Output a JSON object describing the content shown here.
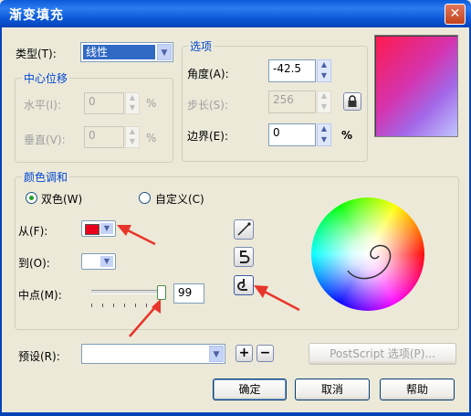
{
  "window": {
    "title": "渐变填充",
    "close_glyph": "✕"
  },
  "type": {
    "label": "类型(T):",
    "value": "线性"
  },
  "center": {
    "title": "中心位移",
    "horizontal": {
      "label": "水平(I):",
      "value": "0",
      "unit": "%"
    },
    "vertical": {
      "label": "垂直(V):",
      "value": "0",
      "unit": "%"
    }
  },
  "options": {
    "title": "选项",
    "angle": {
      "label": "角度(A):",
      "value": "-42.5"
    },
    "steps": {
      "label": "步长(S):",
      "value": "256"
    },
    "edge": {
      "label": "边界(E):",
      "value": "0",
      "unit": "%"
    }
  },
  "blend": {
    "title": "颜色调和",
    "two_color": "双色(W)",
    "custom": "自定义(C)",
    "from": {
      "label": "从(F):",
      "color": "#e8001c"
    },
    "to": {
      "label": "到(O):",
      "color": "#ffffff"
    },
    "midpoint": {
      "label": "中点(M):",
      "value": "99",
      "fraction": 0.99
    }
  },
  "preset": {
    "label": "预设(R):",
    "value": "",
    "add_glyph": "+",
    "remove_glyph": "−"
  },
  "postscript_label": "PostScript 选项(P)...",
  "buttons": {
    "ok": "确定",
    "cancel": "取消",
    "help": "帮助"
  },
  "colors": {
    "accent": "#0046d5",
    "arrow": "#e8352b"
  }
}
